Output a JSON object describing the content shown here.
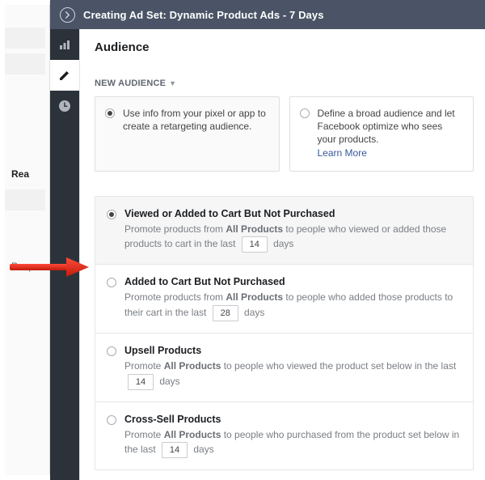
{
  "under": {
    "label1": "Rea",
    "label2": "Peop"
  },
  "header": {
    "title": "Creating Ad Set: Dynamic Product Ads - 7 Days"
  },
  "nav": {
    "items": [
      "chart",
      "pencil",
      "clock"
    ]
  },
  "main": {
    "heading": "Audience",
    "section_label": "NEW AUDIENCE",
    "cards": [
      {
        "text": "Use info from your pixel or app to create a retargeting audience.",
        "selected": true
      },
      {
        "text": "Define a broad audience and let Facebook optimize who sees your products.",
        "link": "Learn More",
        "selected": false
      }
    ],
    "options": [
      {
        "title": "Viewed or Added to Cart But Not Purchased",
        "pre": "Promote products from ",
        "bold": "All Products",
        "mid": " to people who viewed or added those products to cart in the last ",
        "days": "14",
        "post": " days",
        "selected": true
      },
      {
        "title": "Added to Cart But Not Purchased",
        "pre": "Promote products from ",
        "bold": "All Products",
        "mid": " to people who added those products to their cart in the last ",
        "days": "28",
        "post": " days",
        "selected": false
      },
      {
        "title": "Upsell Products",
        "pre": "Promote ",
        "bold": "All Products",
        "mid": " to people who viewed the product set below in the last ",
        "days": "14",
        "post": " days",
        "selected": false
      },
      {
        "title": "Cross-Sell Products",
        "pre": "Promote ",
        "bold": "All Products",
        "mid": " to people who purchased from the product set below in the last ",
        "days": "14",
        "post": " days",
        "selected": false
      }
    ]
  }
}
